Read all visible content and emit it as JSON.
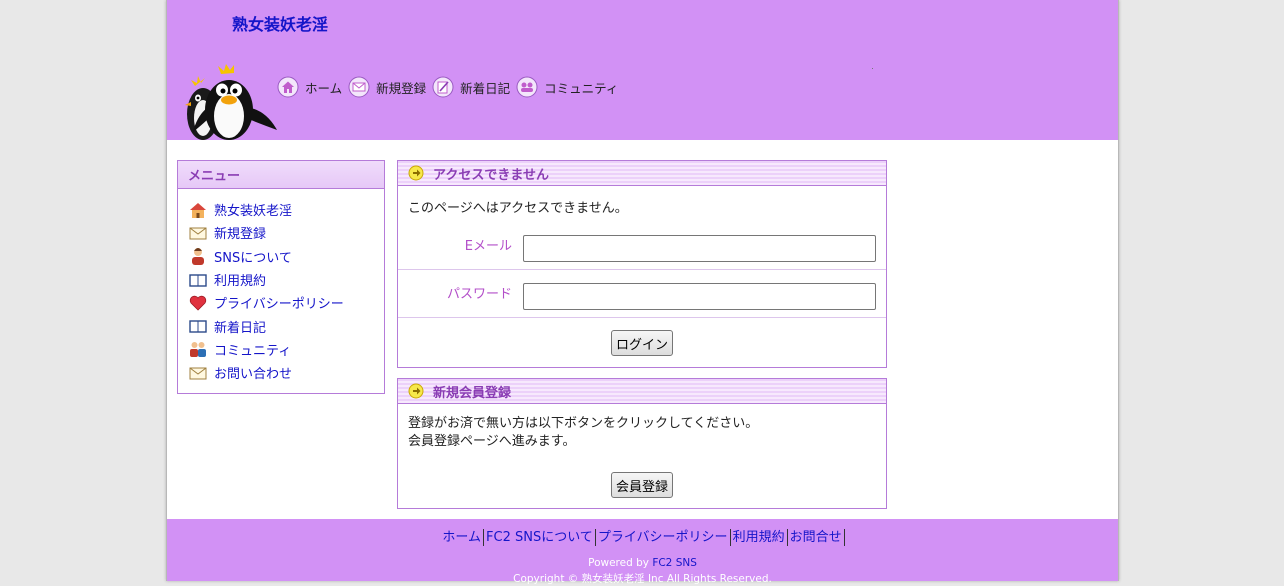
{
  "header": {
    "site_title": "熟女装妖老淫",
    "nav": [
      {
        "label": "ホーム",
        "icon": "home-icon"
      },
      {
        "label": "新規登録",
        "icon": "envelope-icon"
      },
      {
        "label": "新着日記",
        "icon": "diary-icon"
      },
      {
        "label": "コミュニティ",
        "icon": "community-icon"
      }
    ],
    "background": "#d291f5"
  },
  "menu": {
    "title": "メニュー",
    "items": [
      {
        "label": "熟女装妖老淫",
        "icon": "house-icon"
      },
      {
        "label": "新規登録",
        "icon": "envelope-icon"
      },
      {
        "label": "SNSについて",
        "icon": "person-icon"
      },
      {
        "label": "利用規約",
        "icon": "book-icon"
      },
      {
        "label": "プライバシーポリシー",
        "icon": "heart-icon"
      },
      {
        "label": "新着日記",
        "icon": "book-icon"
      },
      {
        "label": "コミュニティ",
        "icon": "people-icon"
      },
      {
        "label": "お問い合わせ",
        "icon": "envelope-icon"
      }
    ]
  },
  "login": {
    "title": "アクセスできません",
    "message": "このページへはアクセスできません。",
    "email_label": "Eメール",
    "email_value": "",
    "password_label": "パスワード",
    "password_value": "",
    "button_label": "ログイン"
  },
  "register": {
    "title": "新規会員登録",
    "line1": "登録がお済で無い方は以下ボタンをクリックしてください。",
    "line2": "会員登録ページへ進みます。",
    "button_label": "会員登録"
  },
  "footer": {
    "links": [
      "ホーム",
      "FC2 SNSについて",
      "プライバシーポリシー",
      "利用規約",
      "お問合せ"
    ],
    "powered_prefix": "Powered by ",
    "powered_brand": "FC2 SNS",
    "copyright": "Copyright © 熟女装妖老淫 Inc All Rights Reserved."
  },
  "colors": {
    "accent": "#d291f5",
    "link": "#1515c9",
    "heading": "#8a3db4",
    "label": "#b34fc9"
  }
}
